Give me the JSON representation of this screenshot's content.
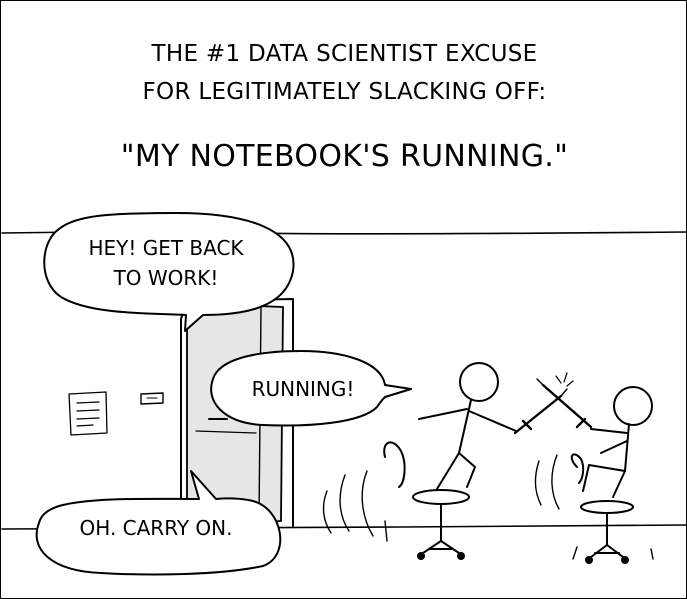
{
  "comic": {
    "caption_line_1": "THE #1 DATA SCIENTIST EXCUSE",
    "caption_line_2": "FOR LEGITIMATELY SLACKING OFF:",
    "caption_quote": "\"MY NOTEBOOK'S RUNNING.\""
  },
  "dialogue": {
    "boss_line_1": "HEY! GET BACK",
    "boss_line_2": "TO WORK!",
    "running": "RUNNING!",
    "carry_on": "OH. CARRY ON."
  },
  "colors": {
    "ink": "#000000",
    "door_fill": "#e6e6e6",
    "background": "#ffffff"
  }
}
